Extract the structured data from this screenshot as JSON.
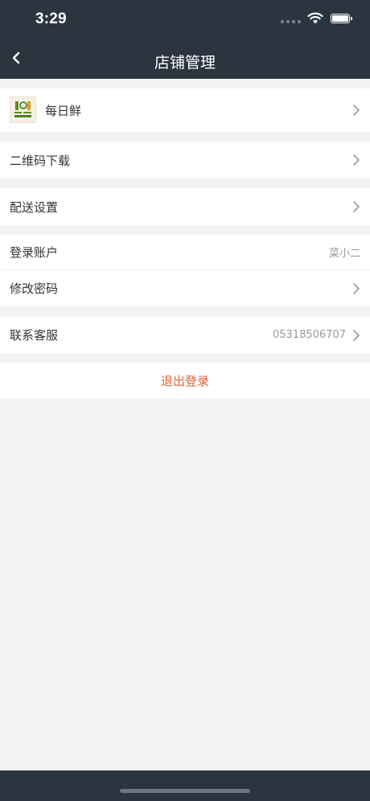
{
  "status_bar": {
    "time": "3:29"
  },
  "nav": {
    "title": "店铺管理"
  },
  "store": {
    "name": "每日鲜"
  },
  "menu": {
    "qr_download": "二维码下载",
    "delivery_settings": "配送设置",
    "login_account": {
      "label": "登录账户",
      "value": "菜小二"
    },
    "change_password": "修改密码",
    "customer_service": {
      "label": "联系客服",
      "value": "05318506707"
    }
  },
  "logout": {
    "label": "退出登录"
  },
  "colors": {
    "header_bg": "#2b3540",
    "page_bg": "#f3f3f3",
    "logout_text": "#e0603a"
  }
}
